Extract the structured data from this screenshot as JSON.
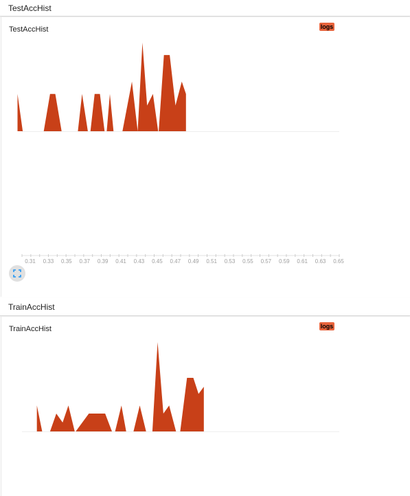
{
  "sections": {
    "test": {
      "header": "TestAccHist",
      "title": "TestAccHist",
      "badge": "logs"
    },
    "train": {
      "header": "TrainAccHist",
      "title": "TrainAccHist",
      "badge": "logs"
    }
  },
  "colors": {
    "fill": "#c84018",
    "badge": "#e8643c",
    "axis_label": "#9e9e9e"
  },
  "icons": {
    "expand": "fullscreen-icon"
  },
  "chart_data": [
    {
      "type": "area",
      "title": "TestAccHist",
      "xlim": [
        0.3,
        0.65
      ],
      "ylim": [
        0,
        1
      ],
      "x_ticks": [
        "0.31",
        "0.33",
        "0.35",
        "0.37",
        "0.39",
        "0.41",
        "0.43",
        "0.45",
        "0.47",
        "0.49",
        "0.51",
        "0.53",
        "0.55",
        "0.57",
        "0.59",
        "0.61",
        "0.63",
        "0.65"
      ],
      "points": [
        [
          0.3075,
          0
        ],
        [
          0.3075,
          0.42
        ],
        [
          0.3125,
          0
        ],
        [
          0.3325,
          0
        ],
        [
          0.3385,
          0.42
        ],
        [
          0.3435,
          0.42
        ],
        [
          0.3495,
          0
        ],
        [
          0.365,
          0
        ],
        [
          0.369,
          0.42
        ],
        [
          0.3745,
          0
        ],
        [
          0.377,
          0
        ],
        [
          0.381,
          0.42
        ],
        [
          0.386,
          0.42
        ],
        [
          0.3905,
          0
        ],
        [
          0.3925,
          0
        ],
        [
          0.3955,
          0.42
        ],
        [
          0.399,
          0
        ],
        [
          0.4075,
          0
        ],
        [
          0.4165,
          0.56
        ],
        [
          0.422,
          0
        ],
        [
          0.422,
          0
        ],
        [
          0.4265,
          1
        ],
        [
          0.431,
          0.29
        ],
        [
          0.4365,
          0.42
        ],
        [
          0.4415,
          0
        ],
        [
          0.442,
          0
        ],
        [
          0.447,
          0.86
        ],
        [
          0.4525,
          0.86
        ],
        [
          0.458,
          0.29
        ],
        [
          0.464,
          0.56
        ],
        [
          0.468,
          0.42
        ],
        [
          0.468,
          0
        ]
      ]
    },
    {
      "type": "area",
      "title": "TrainAccHist",
      "xlim": [
        0.3,
        0.65
      ],
      "ylim": [
        0,
        1
      ],
      "points": [
        [
          0.326,
          0
        ],
        [
          0.326,
          0.29
        ],
        [
          0.331,
          0
        ],
        [
          0.3385,
          0
        ],
        [
          0.3445,
          0.2
        ],
        [
          0.3505,
          0.1
        ],
        [
          0.356,
          0.29
        ],
        [
          0.362,
          0
        ],
        [
          0.363,
          0
        ],
        [
          0.3755,
          0.2
        ],
        [
          0.391,
          0.2
        ],
        [
          0.3975,
          0
        ],
        [
          0.4005,
          0
        ],
        [
          0.4065,
          0.29
        ],
        [
          0.411,
          0
        ],
        [
          0.418,
          0
        ],
        [
          0.424,
          0.29
        ],
        [
          0.43,
          0
        ],
        [
          0.436,
          0
        ],
        [
          0.441,
          1
        ],
        [
          0.4465,
          0.2
        ],
        [
          0.452,
          0.29
        ],
        [
          0.4585,
          0
        ],
        [
          0.4625,
          0
        ],
        [
          0.469,
          0.6
        ],
        [
          0.475,
          0.6
        ],
        [
          0.48,
          0.42
        ],
        [
          0.485,
          0.5
        ],
        [
          0.485,
          0
        ]
      ]
    }
  ]
}
